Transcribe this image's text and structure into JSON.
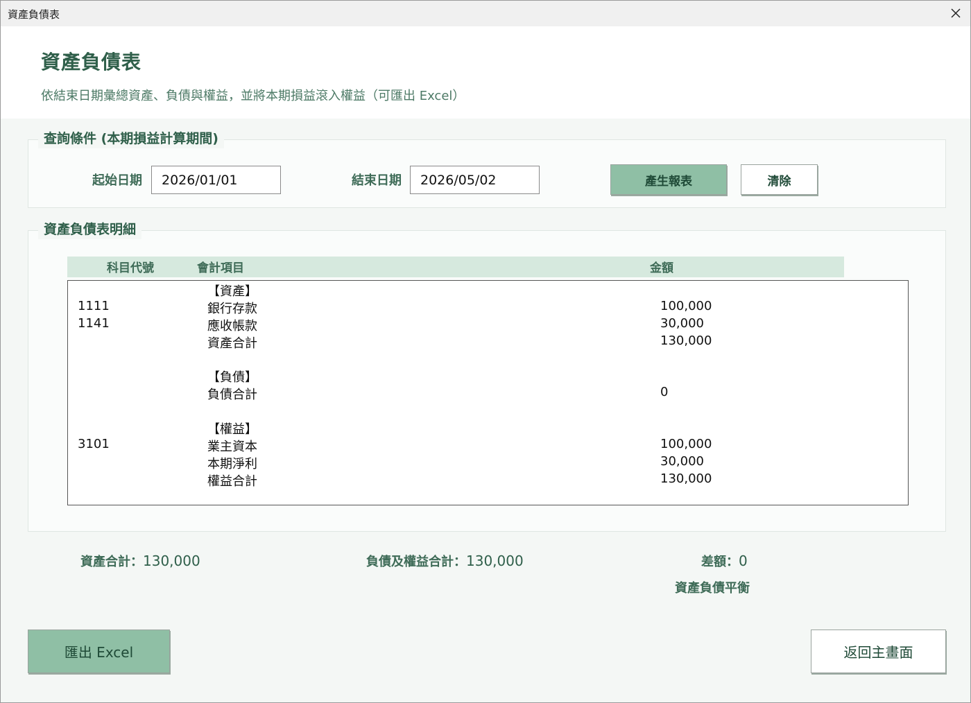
{
  "window": {
    "title": "資產負債表"
  },
  "header": {
    "title": "資產負債表",
    "subtitle": "依結束日期彙總資產、負債與權益，並將本期損益滾入權益（可匯出 Excel）"
  },
  "query": {
    "legend": "查詢條件 (本期損益計算期間)",
    "start_label": "起始日期",
    "start_value": "2026/01/01",
    "end_label": "結束日期",
    "end_value": "2026/05/02",
    "generate_label": "產生報表",
    "clear_label": "清除"
  },
  "detail": {
    "legend": "資產負債表明細",
    "columns": [
      "科目代號",
      "會計項目",
      "金額"
    ],
    "rows": [
      {
        "code": "",
        "item": "【資產】",
        "amount": ""
      },
      {
        "code": "1111",
        "item": "銀行存款",
        "amount": "100,000"
      },
      {
        "code": "1141",
        "item": "應收帳款",
        "amount": "30,000"
      },
      {
        "code": "",
        "item": "資產合計",
        "amount": "130,000"
      },
      {
        "code": "",
        "item": "",
        "amount": ""
      },
      {
        "code": "",
        "item": "【負債】",
        "amount": ""
      },
      {
        "code": "",
        "item": "負債合計",
        "amount": "0"
      },
      {
        "code": "",
        "item": "",
        "amount": ""
      },
      {
        "code": "",
        "item": "【權益】",
        "amount": ""
      },
      {
        "code": "3101",
        "item": "業主資本",
        "amount": "100,000"
      },
      {
        "code": "",
        "item": "本期淨利",
        "amount": "30,000"
      },
      {
        "code": "",
        "item": "權益合計",
        "amount": "130,000"
      }
    ]
  },
  "summary": {
    "assets_label": "資產合計：",
    "assets_value": "130,000",
    "liab_equity_label": "負債及權益合計：",
    "liab_equity_value": "130,000",
    "diff_label": "差額：",
    "diff_value": "0",
    "balance_status": "資產負債平衡"
  },
  "footer": {
    "export_label": "匯出 Excel",
    "back_label": "返回主畫面"
  }
}
